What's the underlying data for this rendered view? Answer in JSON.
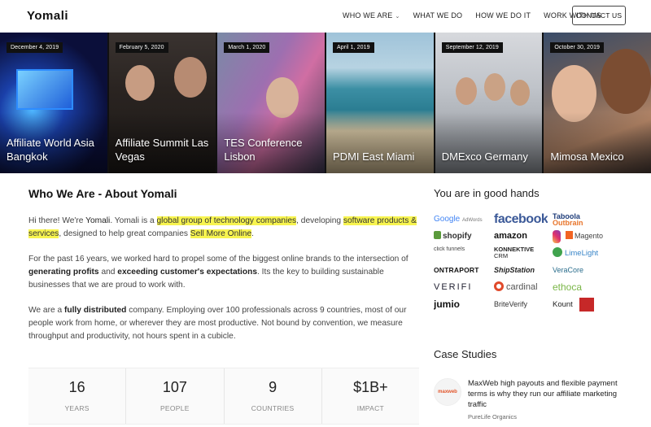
{
  "header": {
    "logo": "Yomali",
    "nav": [
      {
        "label": "WHO WE ARE",
        "has_dropdown": true
      },
      {
        "label": "WHAT WE DO"
      },
      {
        "label": "HOW WE DO IT"
      },
      {
        "label": "WORK WITH US"
      }
    ],
    "contact_label": "CONTACT US"
  },
  "events": [
    {
      "date": "December 4, 2019",
      "title": "Affiliate World Asia Bangkok"
    },
    {
      "date": "February 5, 2020",
      "title": "Affiliate Summit Las Vegas"
    },
    {
      "date": "March 1, 2020",
      "title": "TES Conference Lisbon"
    },
    {
      "date": "April 1, 2019",
      "title": "PDMI East Miami"
    },
    {
      "date": "September 12, 2019",
      "title": "DMExco Germany"
    },
    {
      "date": "October 30, 2019",
      "title": "Mimosa Mexico"
    }
  ],
  "about": {
    "heading": "Who We Are - About Yomali",
    "p1": {
      "a": "Hi there!   We're ",
      "b": "Yomali",
      "c": ".   Yomali is a ",
      "hl1": "global group of technology companies",
      "d": ", developing ",
      "hl2": "software products & services",
      "e": ", designed to help great companies ",
      "hl3": "Sell More Online",
      "f": "."
    },
    "p2": {
      "a": "For the past 16 years, we worked hard to propel some of the biggest online brands to the intersection of ",
      "b": "generating profits",
      "c": " and ",
      "d": "exceeding customer's expectations",
      "e": ".    Its the key to building sustainable businesses that we are proud to work with."
    },
    "p3": {
      "a": "We are a ",
      "b": "fully distributed",
      "c": " company. Employing over 100 professionals across 9 countries, most of our people work from home, or wherever they are most productive. Not bound by convention, we measure throughput and productivity, not hours spent in a cubicle."
    }
  },
  "stats": [
    {
      "value": "16",
      "label": "YEARS"
    },
    {
      "value": "107",
      "label": "PEOPLE"
    },
    {
      "value": "9",
      "label": "COUNTRIES"
    },
    {
      "value": "$1B+",
      "label": "IMPACT"
    }
  ],
  "sidebar": {
    "hands_title": "You are in good hands",
    "brands": {
      "google": "Google",
      "google_sub": "AdWords",
      "facebook": "facebook",
      "taboola": "Taboola",
      "outbrain": "Outbrain",
      "shopify": "shopify",
      "amazon": "amazon",
      "magento": "Magento",
      "clickfunnels": "click funnels",
      "konnektive": "KONNEKTIVE",
      "konnektive_sub": "CRM",
      "limelight": "LimeLight",
      "ontraport": "ONTRAPORT",
      "shipstation": "ShipStation",
      "veracore": "VeraCore",
      "verifi": "VERIFI",
      "cardinal": "cardinal",
      "ethoca": "ethoca",
      "jumio": "jumio",
      "briteverify": "BriteVerify",
      "kount": "Kount"
    },
    "cases_title": "Case Studies",
    "case": {
      "logo": "maxweb",
      "text": "MaxWeb high payouts and flexible payment terms is why they run our affiliate marketing traffic",
      "source": "PureLife Organics"
    }
  }
}
